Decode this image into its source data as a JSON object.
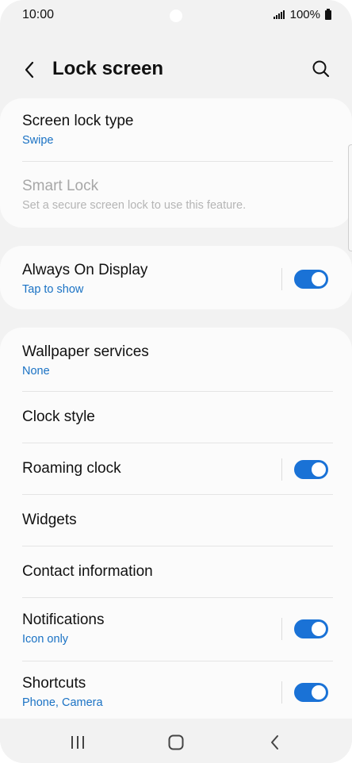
{
  "status_bar": {
    "time": "10:00",
    "battery": "100%"
  },
  "header": {
    "title": "Lock screen"
  },
  "section1": {
    "screen_lock_type": {
      "title": "Screen lock type",
      "subtitle": "Swipe"
    },
    "smart_lock": {
      "title": "Smart Lock",
      "subtitle": "Set a secure screen lock to use this feature.",
      "enabled": false
    }
  },
  "section2": {
    "always_on_display": {
      "title": "Always On Display",
      "subtitle": "Tap to show",
      "toggle_on": true
    }
  },
  "section3": {
    "wallpaper_services": {
      "title": "Wallpaper services",
      "subtitle": "None"
    },
    "clock_style": {
      "title": "Clock style"
    },
    "roaming_clock": {
      "title": "Roaming clock",
      "toggle_on": true
    },
    "widgets": {
      "title": "Widgets"
    },
    "contact_information": {
      "title": "Contact information"
    },
    "notifications": {
      "title": "Notifications",
      "subtitle": "Icon only",
      "toggle_on": true
    },
    "shortcuts": {
      "title": "Shortcuts",
      "subtitle": "Phone, Camera",
      "toggle_on": true
    }
  },
  "colors": {
    "accent": "#1a72d6",
    "subtitle_blue": "#1a72c4",
    "background": "#f2f2f2",
    "card": "#fbfbfb"
  },
  "nav_bar": {
    "recents_icon": "recents-icon",
    "home_icon": "home-icon",
    "back_icon": "back-nav-icon"
  }
}
